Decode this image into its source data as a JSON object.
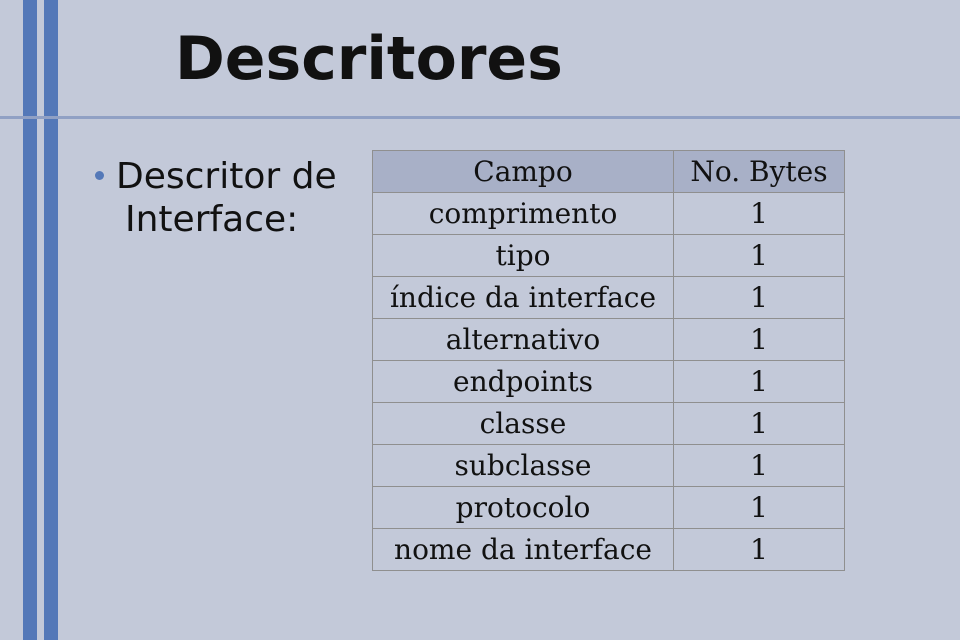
{
  "title": "Descritores",
  "bullet": {
    "line1": "Descritor de",
    "line2": "Interface:"
  },
  "table": {
    "headers": {
      "field": "Campo",
      "bytes": "No. Bytes"
    },
    "rows": [
      {
        "field": "comprimento",
        "bytes": "1"
      },
      {
        "field": "tipo",
        "bytes": "1"
      },
      {
        "field": "índice da interface",
        "bytes": "1"
      },
      {
        "field": "alternativo",
        "bytes": "1"
      },
      {
        "field": "endpoints",
        "bytes": "1"
      },
      {
        "field": "classe",
        "bytes": "1"
      },
      {
        "field": "subclasse",
        "bytes": "1"
      },
      {
        "field": "protocolo",
        "bytes": "1"
      },
      {
        "field": "nome da interface",
        "bytes": "1"
      }
    ]
  }
}
